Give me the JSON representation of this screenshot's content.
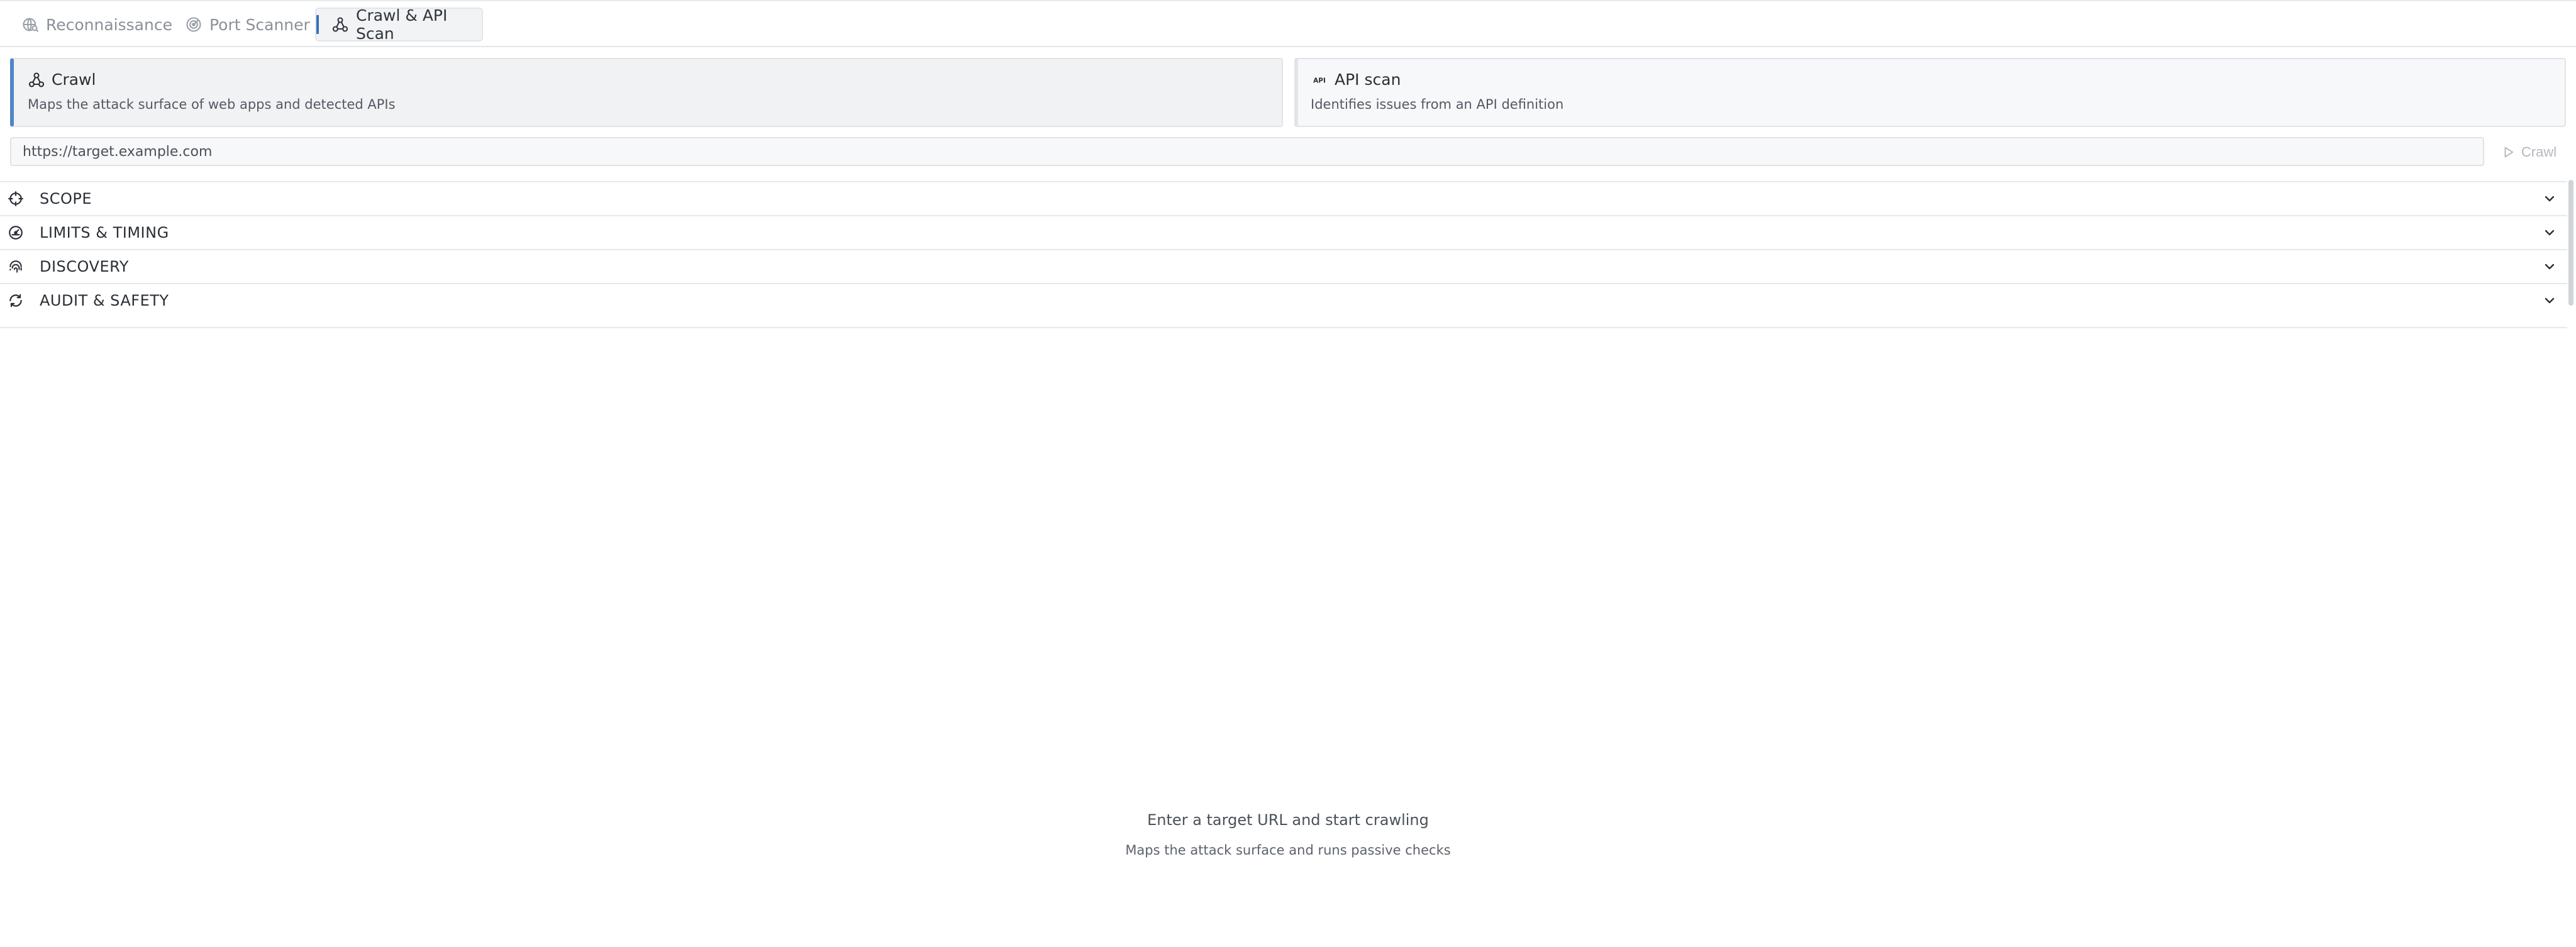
{
  "tabs": [
    {
      "label": "Reconnaissance",
      "icon": "radar-globe-icon",
      "active": false
    },
    {
      "label": "Port Scanner",
      "icon": "target-radar-icon",
      "active": false
    },
    {
      "label": "Crawl & API Scan",
      "icon": "network-nodes-icon",
      "active": true
    }
  ],
  "modes": {
    "crawl": {
      "title": "Crawl",
      "description": "Maps the attack surface of web apps and detected APIs",
      "icon": "network-nodes-icon",
      "selected": true
    },
    "api": {
      "title": "API scan",
      "description": "Identifies issues from an API definition",
      "icon": "api-icon",
      "icon_text": "API",
      "selected": false
    }
  },
  "url": {
    "value": "https://target.example.com",
    "placeholder": "https://target.example.com"
  },
  "run_button": {
    "label": "Crawl",
    "enabled": false
  },
  "sections": [
    {
      "label": "SCOPE",
      "icon": "crosshair-icon",
      "expanded": false
    },
    {
      "label": "LIMITS & TIMING",
      "icon": "gauge-icon",
      "expanded": false
    },
    {
      "label": "DISCOVERY",
      "icon": "fingerprint-icon",
      "expanded": false
    },
    {
      "label": "AUDIT & SAFETY",
      "icon": "refresh-shield-icon",
      "expanded": false
    }
  ],
  "empty_state": {
    "title": "Enter a target URL and start crawling",
    "subtitle": "Maps the attack surface and runs passive checks"
  },
  "colors": {
    "accent": "#4f86c6",
    "active_tab_marker": "#3b6fb6",
    "border": "#e1e4e8",
    "muted_text": "#8b9099"
  }
}
